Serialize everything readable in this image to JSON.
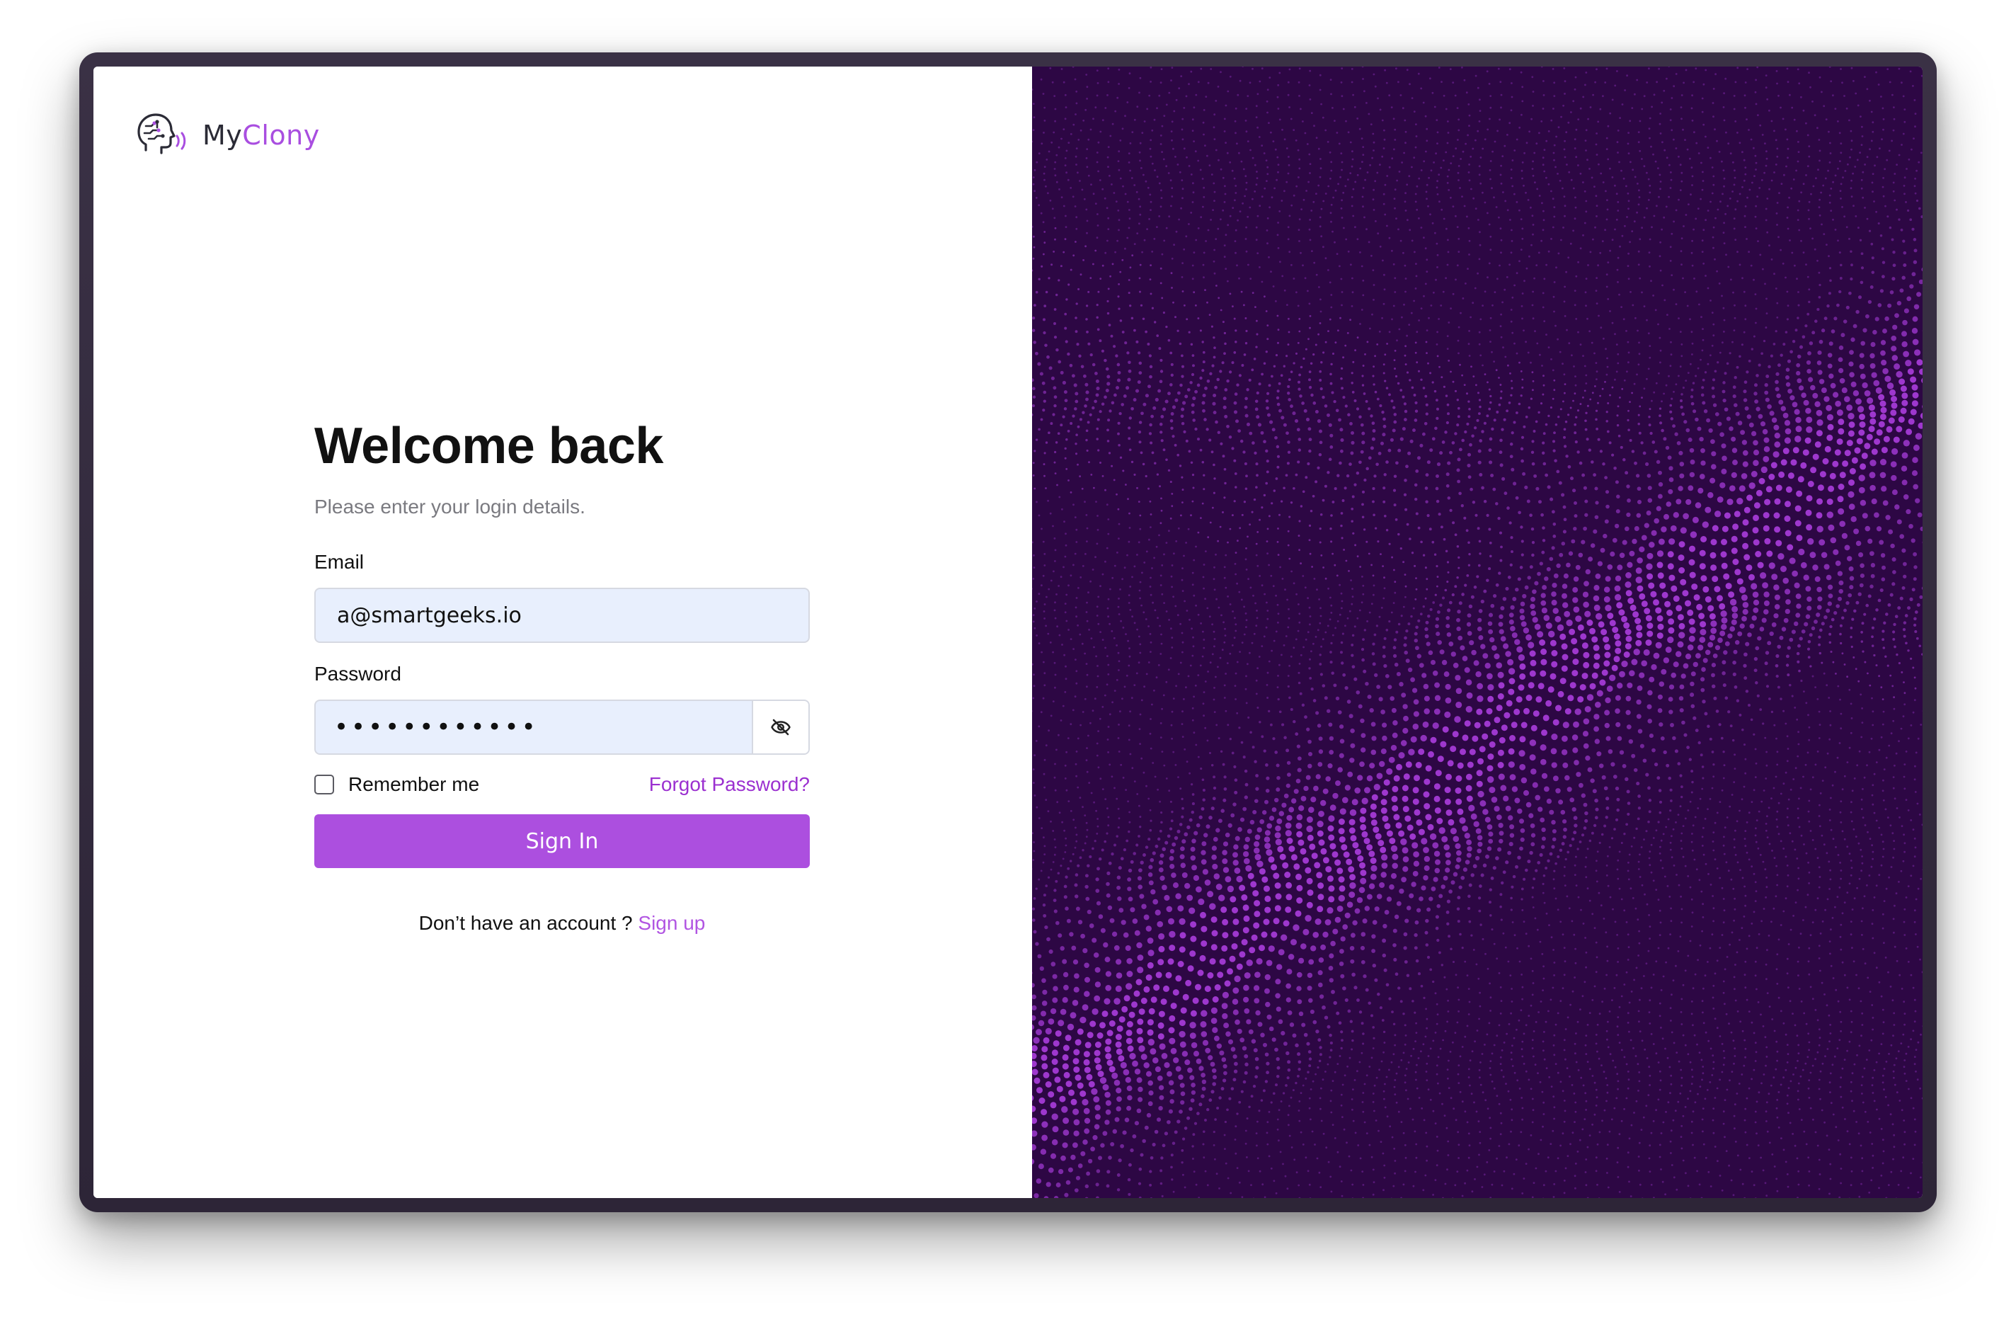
{
  "brand": {
    "name_part1": "My",
    "name_part2": "Clony",
    "accent_color": "#a94ee0",
    "icon": "head-with-signal-icon"
  },
  "login": {
    "title": "Welcome back",
    "subtitle": "Please enter your login details.",
    "email_label": "Email",
    "email_value": "a@smartgeeks.io",
    "password_label": "Password",
    "password_value": "••••••••••••",
    "password_toggle_icon": "eye-off-icon",
    "remember_label": "Remember me",
    "remember_checked": false,
    "forgot_label": "Forgot Password?",
    "signin_label": "Sign In",
    "signup_prompt": "Don’t have an account ?",
    "signup_label": "Sign up"
  },
  "colors": {
    "primary_button": "#ac4fdf",
    "link": "#9b30d0",
    "input_bg": "#e8effd",
    "hero_bg": "#2d0744",
    "hero_dots": "#a43ad6"
  }
}
